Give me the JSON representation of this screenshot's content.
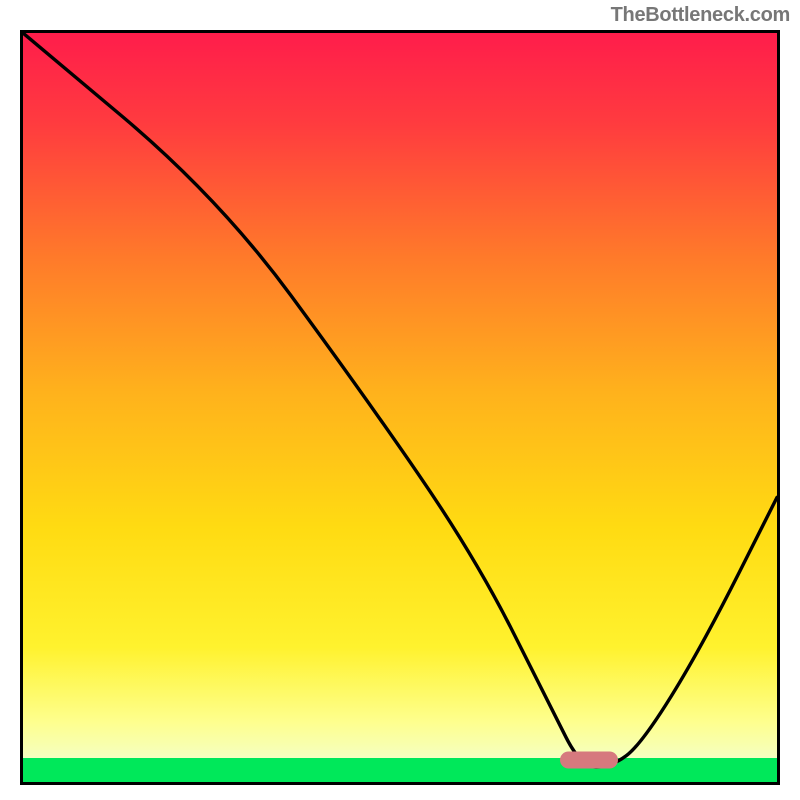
{
  "watermark": "TheBottleneck.com",
  "colors": {
    "border": "#000000",
    "curve": "#000000",
    "marker": "#d6797e",
    "green": "#00e85a",
    "gradient_top": "#ff1d4b",
    "gradient_mid1": "#ff9a1f",
    "gradient_mid2": "#ffe500",
    "gradient_bot": "#fdfcb4"
  },
  "chart_data": {
    "type": "line",
    "title": "",
    "xlabel": "",
    "ylabel": "",
    "xlim": [
      0,
      100
    ],
    "ylim": [
      0,
      100
    ],
    "grid": false,
    "legend": false,
    "minimum_marker_x": 75,
    "bottleneck_curve": {
      "x": [
        0,
        26,
        45,
        60,
        70,
        74,
        78,
        82,
        90,
        100
      ],
      "y": [
        100,
        78,
        52,
        30,
        10,
        2,
        2,
        5,
        18,
        38
      ]
    },
    "gradient_bands": [
      {
        "y_start": 100,
        "y_end": 10,
        "type": "red-to-yellow-continuous"
      },
      {
        "y_start": 10,
        "y_end": 3,
        "type": "yellow-to-pale"
      },
      {
        "y_start": 3,
        "y_end": 0,
        "type": "green-solid"
      }
    ],
    "notes": "V-shaped bottleneck curve; x-axis represents component balance, y-axis represents bottleneck %. Minimum (optimal point) near x≈75 highlighted by rounded red marker on baseline. Background fill is vertical heat gradient from red (high bottleneck) through orange/yellow to pale then a thin green strip at y≈0–3."
  }
}
